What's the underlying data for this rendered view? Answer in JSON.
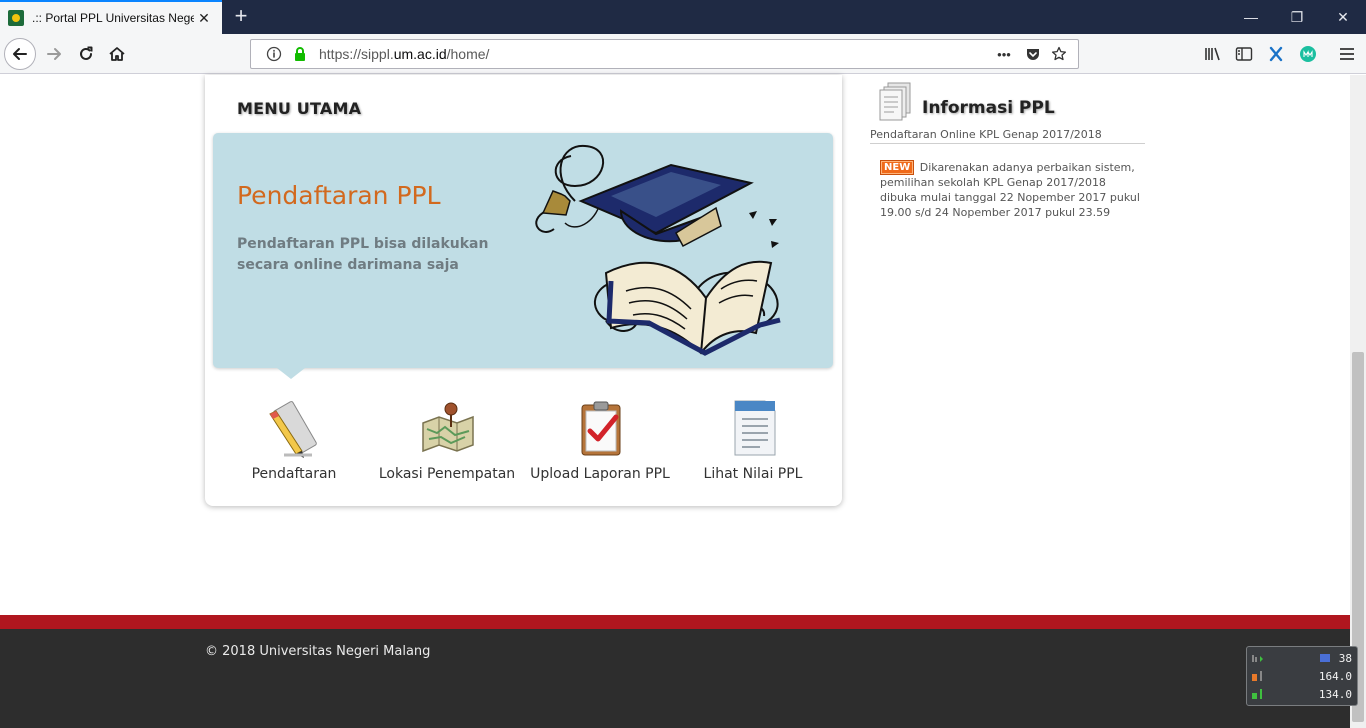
{
  "browser": {
    "tab_title": ".:: Portal PPL Universitas Negeri Malang ::.",
    "tab_close": "✕",
    "new_tab": "+",
    "url_prefix": "https://sippl.",
    "url_host": "um.ac.id",
    "url_path": "/home/",
    "page_actions": "•••",
    "window_controls": {
      "minimize": "—",
      "restore": "❐",
      "close": "✕"
    }
  },
  "menu": {
    "title": "MENU UTAMA",
    "banner": {
      "title": "Pendaftaran PPL",
      "text": "Pendaftaran PPL bisa dilakukan secara online darimana saja"
    },
    "items": [
      {
        "label": "Pendaftaran",
        "icon": "pencil-ruler-icon"
      },
      {
        "label": "Lokasi Penempatan",
        "icon": "map-pin-icon"
      },
      {
        "label": "Upload Laporan PPL",
        "icon": "clipboard-check-icon"
      },
      {
        "label": "Lihat Nilai PPL",
        "icon": "document-icon"
      }
    ]
  },
  "info": {
    "title": "Informasi PPL",
    "subtitle": "Pendaftaran Online KPL Genap 2017/2018",
    "badge": "NEW",
    "body": "Dikarenakan adanya perbaikan sistem, pemilihan sekolah KPL Genap 2017/2018 dibuka mulai tanggal 22 Nopember 2017 pukul 19.00 s/d 24 Nopember 2017 pukul 23.59"
  },
  "footer": {
    "copyright": "© 2018 Universitas Negeri Malang"
  },
  "meter": {
    "values": [
      "38",
      "164.0",
      "134.0"
    ]
  },
  "colors": {
    "titlebar": "#1f2a44",
    "banner_bg": "#c0dde5",
    "banner_title": "#d2691e",
    "footer_stripe": "#b0161f",
    "footer_bg": "#2d2d2d",
    "new_badge": "#f06a1a"
  }
}
